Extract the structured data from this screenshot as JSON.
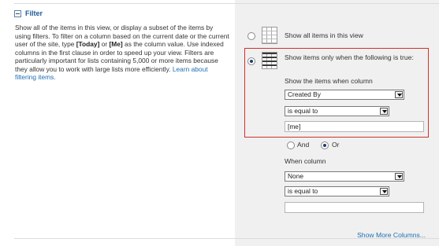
{
  "section": {
    "title": "Filter",
    "description_parts": [
      {
        "t": "Show all of the items in this view, or display a subset of the items by using filters. To filter on a column based on the current date or the current user of the site, type ",
        "style": "normal"
      },
      {
        "t": "[Today]",
        "style": "bold"
      },
      {
        "t": " or ",
        "style": "normal"
      },
      {
        "t": "[Me]",
        "style": "bold"
      },
      {
        "t": " as the column value. Use indexed columns in the first clause in order to speed up your view. Filters are particularly important for lists containing 5,000 or more items because they allow you to work with large lists more efficiently. ",
        "style": "normal"
      },
      {
        "t": "Learn about filtering items.",
        "style": "link"
      }
    ]
  },
  "filter": {
    "show_all_label": "Show all items in this view",
    "show_filtered_label": "Show items only when the following is true:",
    "selected_mode": "filtered",
    "when_column_label_1": "Show the items when column",
    "clause1": {
      "column": "Created By",
      "operator": "is equal to",
      "value": "[me]"
    },
    "connector": {
      "and_label": "And",
      "or_label": "Or",
      "selected": "Or"
    },
    "when_column_label_2": "When column",
    "clause2": {
      "column": "None",
      "operator": "is equal to",
      "value": ""
    },
    "show_more_label": "Show More Columns..."
  },
  "colors": {
    "accent_link": "#1f6fb3",
    "highlight_border": "#d0312d",
    "panel_bg": "#f0f0f0"
  }
}
